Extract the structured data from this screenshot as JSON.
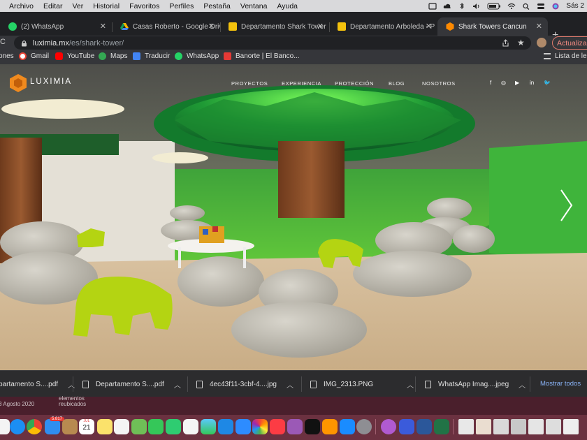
{
  "menubar": {
    "items": [
      "Archivo",
      "Editar",
      "Ver",
      "Historial",
      "Favoritos",
      "Perfiles",
      "Pestaña",
      "Ventana",
      "Ayuda"
    ],
    "clock": "Sás 2"
  },
  "tabs": [
    {
      "title": "(2) WhatsApp",
      "favicon_color": "#25d366"
    },
    {
      "title": "Casas Roberto - Google Drive",
      "favicon_color": "#f4b400"
    },
    {
      "title": "Departamento Shark Tower",
      "favicon_color": "#f4c20d"
    },
    {
      "title": "Departamento Arboleda - P",
      "favicon_color": "#f4c20d"
    },
    {
      "title": "Shark Towers Cancun",
      "favicon_color": "#ff8a00"
    }
  ],
  "address": {
    "host": "luximia.mx",
    "path": "/es/shark-tower/"
  },
  "update_label": "Actualizar",
  "bookmarks": {
    "truncated_left": "ones",
    "items": [
      {
        "label": "Gmail",
        "color": "#ea4335"
      },
      {
        "label": "YouTube",
        "color": "#ff0000"
      },
      {
        "label": "Maps",
        "color": "#34a853"
      },
      {
        "label": "Traducir",
        "color": "#4285f4"
      },
      {
        "label": "WhatsApp",
        "color": "#25d366"
      },
      {
        "label": "Banorte | El Banco...",
        "color": "#e53935"
      }
    ],
    "reading_list": "Lista de lec"
  },
  "site": {
    "brand": "LUXIMIA",
    "nav": [
      "PROYECTOS",
      "EXPERIENCIA",
      "PROTECCIÓN",
      "BLOG",
      "NOSOTROS"
    ],
    "social_icons": [
      "f",
      "◎",
      "▶",
      "in",
      "🐦"
    ]
  },
  "downloads": [
    {
      "name": "partamento S....pdf"
    },
    {
      "name": "Departamento S....pdf"
    },
    {
      "name": "4ec43f11-3cbf-4....jpg"
    },
    {
      "name": "IMG_2313.PNG"
    },
    {
      "name": "WhatsApp Imag....jpeg"
    }
  ],
  "show_all_label": "Mostrar todos",
  "desktop": {
    "left_text": "3 Agosto 2020",
    "middle_line1": "elementos",
    "middle_line2": "reubicados"
  },
  "dock": {
    "calendar_month": "JUL",
    "calendar_day": "21",
    "mail_badge": "5.817"
  }
}
